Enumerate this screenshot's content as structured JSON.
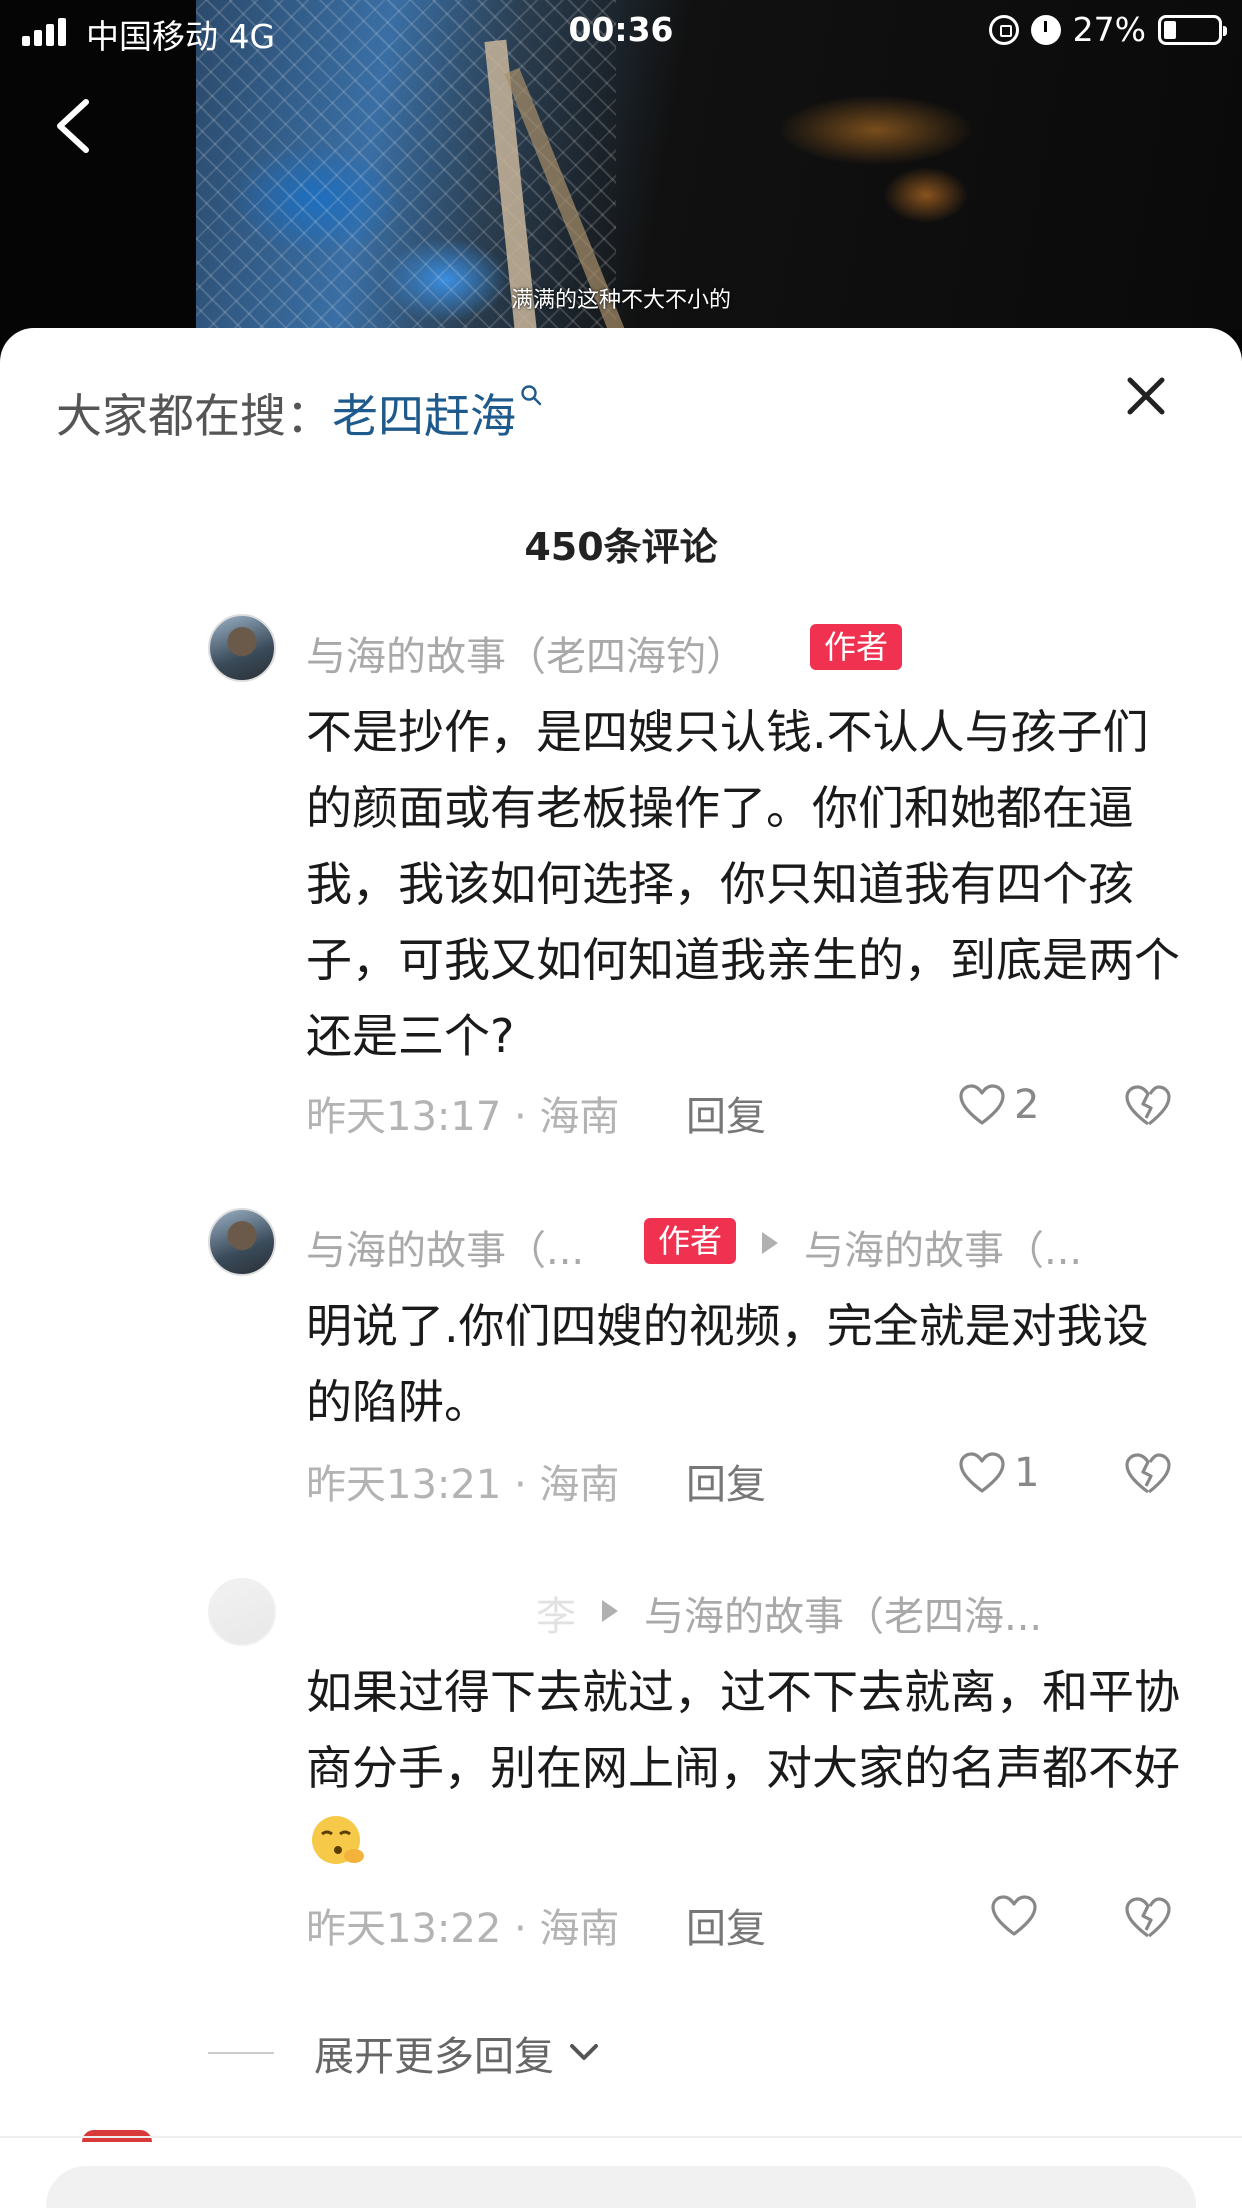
{
  "status_bar": {
    "carrier": "中国移动  4G",
    "time": "00:36",
    "battery": "27%",
    "icons": [
      "signal-icon",
      "orientation-lock-icon",
      "alarm-icon",
      "battery-icon"
    ]
  },
  "video": {
    "subtitle": "满满的这种不大不小的"
  },
  "sheet": {
    "search_prefix": "大家都在搜：",
    "search_term": "老四赶海",
    "comment_count": "450条评论",
    "comments": [
      {
        "name": "与海的故事（老四海钓）",
        "tag": "作者",
        "content": "不是抄作，是四嫂只认钱.不认人与孩子们的颜面或有老板操作了。你们和她都在逼我，我该如何选择，你只知道我有四个孩子，可我又如何知道我亲生的，到底是两个还是三个?",
        "meta": "昨天13:17 · 海南",
        "reply": "回复",
        "likes": "2"
      },
      {
        "name": "与海的故事（...",
        "tag": "作者",
        "reply_to": "与海的故事（...",
        "content": "明说了.你们四嫂的视频，完全就是对我设的陷阱。",
        "meta": "昨天13:21 · 海南",
        "reply": "回复",
        "likes": "1"
      },
      {
        "name": "李",
        "reply_to": "与海的故事（老四海...",
        "content": "如果过得下去就过，过不下去就离，和平协商分手，别在网上闹，对大家的名声都不好",
        "meta": "昨天13:22 · 海南",
        "reply": "回复",
        "likes": ""
      }
    ],
    "expand": "展开更多回复"
  },
  "colors": {
    "accent_red": "#f0314f",
    "search_blue": "#1f5a8c"
  }
}
